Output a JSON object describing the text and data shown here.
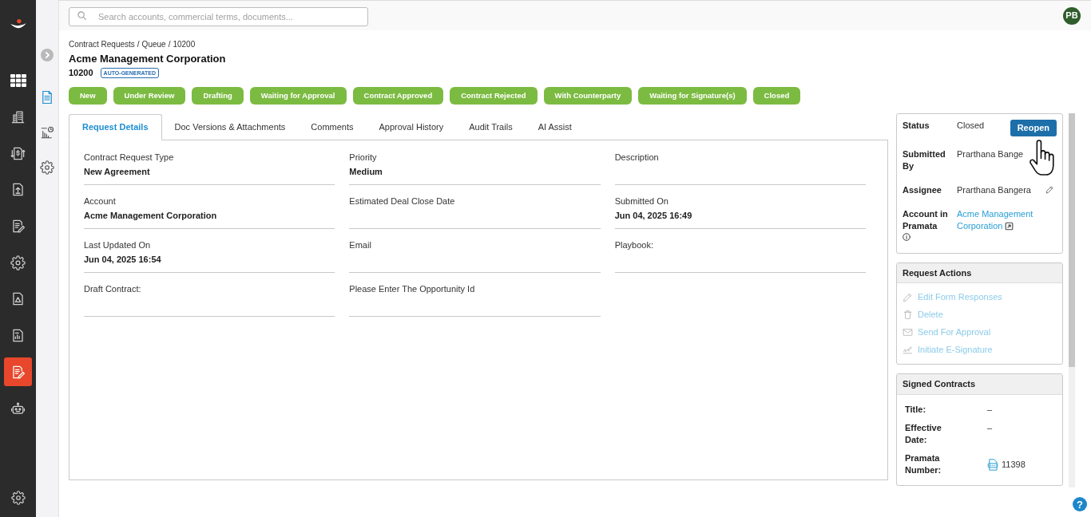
{
  "sidebar": {
    "nav": [
      {
        "selected": false
      },
      {
        "selected": false
      },
      {
        "selected": false
      },
      {
        "selected": false
      },
      {
        "selected": false
      },
      {
        "selected": false
      },
      {
        "selected": false
      },
      {
        "selected": false
      },
      {
        "selected": true
      },
      {
        "selected": false
      }
    ]
  },
  "subnav": [
    {
      "selected": true
    },
    {
      "selected": false
    },
    {
      "selected": false
    }
  ],
  "search": {
    "placeholder": "Search accounts, commercial terms, documents..."
  },
  "user": {
    "initials": "PB"
  },
  "breadcrumb": {
    "items": [
      "Contract Requests",
      "Queue",
      "10200"
    ],
    "separator": "/"
  },
  "header": {
    "title": "Acme Management Corporation",
    "request_id": "10200",
    "id_badge": "AUTO-GENERATED"
  },
  "status_steps": [
    "New",
    "Under Review",
    "Drafting",
    "Waiting for Approval",
    "Contract Approved",
    "Contract Rejected",
    "With Counterparty",
    "Waiting for Signature(s)",
    "Closed"
  ],
  "tabs": [
    {
      "label": "Request Details",
      "selected": true
    },
    {
      "label": "Doc Versions & Attachments",
      "selected": false
    },
    {
      "label": "Comments",
      "selected": false
    },
    {
      "label": "Approval History",
      "selected": false
    },
    {
      "label": "Audit Trails",
      "selected": false
    },
    {
      "label": "AI Assist",
      "selected": false
    }
  ],
  "fields": [
    {
      "label": "Contract Request Type",
      "value": "New Agreement"
    },
    {
      "label": "Priority",
      "value": "Medium"
    },
    {
      "label": "Description"
    },
    {
      "label": "Account",
      "value": "Acme Management Corporation"
    },
    {
      "label": "Estimated Deal Close Date"
    },
    {
      "label": "Submitted On",
      "value": "Jun 04, 2025 16:49"
    },
    {
      "label": "Last Updated On",
      "value": "Jun 04, 2025 16:54"
    },
    {
      "label": "Email"
    },
    {
      "label": "Playbook:"
    },
    {
      "label": "Draft Contract:"
    },
    {
      "label": "Please Enter The Opportunity Id"
    }
  ],
  "summary": {
    "rows": [
      {
        "kind": "action",
        "label": "Status",
        "value": "Closed",
        "button": "Reopen"
      },
      {
        "kind": "text",
        "label": "Submitted By",
        "value": "Prarthana Bange"
      },
      {
        "kind": "editable",
        "label": "Assignee",
        "value": "Prarthana Bangera"
      },
      {
        "kind": "link",
        "label": "Account in Pramata",
        "value": "Acme Management Corporation"
      }
    ]
  },
  "request_actions": {
    "title": "Request Actions",
    "items": [
      {
        "label": "Edit Form Responses",
        "disabled": true
      },
      {
        "label": "Delete",
        "disabled": true
      },
      {
        "label": "Send For Approval",
        "disabled": true
      },
      {
        "label": "Initiate E-Signature",
        "disabled": true
      }
    ]
  },
  "signed_contracts": {
    "title": "Signed Contracts",
    "rows": [
      {
        "kind": "text",
        "label": "Title:",
        "value": "–"
      },
      {
        "kind": "text",
        "label": "Effective Date:",
        "value": "–"
      },
      {
        "kind": "pdf",
        "label": "Pramata Number:",
        "value": "11398"
      }
    ]
  },
  "help": {
    "label": "?"
  }
}
